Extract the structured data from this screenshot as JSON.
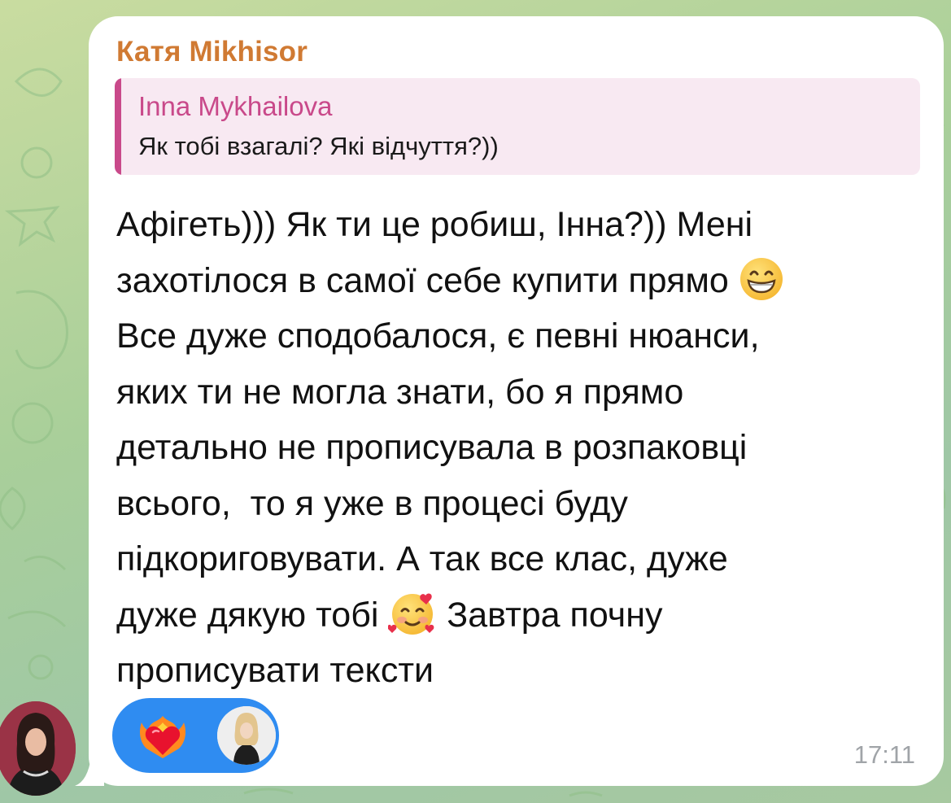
{
  "chat": {
    "sender_name": "Катя Mikhisor",
    "reply": {
      "author": "Inna Mykhailova",
      "text": "Як тобі взагалі? Які відчуття?))"
    },
    "message_lines": [
      "Афігеть))) Як ти це робиш, Інна?)) Мені",
      "захотілося в самої себе купити прямо",
      "Все дуже сподобалося, є певні нюанси,",
      "яких ти не могла знати, бо я прямо",
      "детально не прописувала в розпаковці",
      "всього,  то я уже в процесі буду",
      "підкориговувати. А так все клас, дуже",
      "дуже дякую тобі",
      "Завтра почну",
      "прописувати тексти"
    ],
    "inline_emojis": [
      "grinning-face-emoji",
      "smiling-face-with-hearts-emoji"
    ],
    "time": "17:11",
    "reactions": {
      "emoji": "heart-on-fire-emoji",
      "reactor_avatar": "reactor-avatar"
    },
    "sender_avatar": "sender-avatar"
  },
  "colors": {
    "sender_name": "#d07a33",
    "reply_accent": "#c9498a",
    "reply_bg": "#f8e9f2",
    "reaction_pill": "#2f8cf1",
    "time": "#a0a4a8",
    "bubble": "#ffffff"
  }
}
